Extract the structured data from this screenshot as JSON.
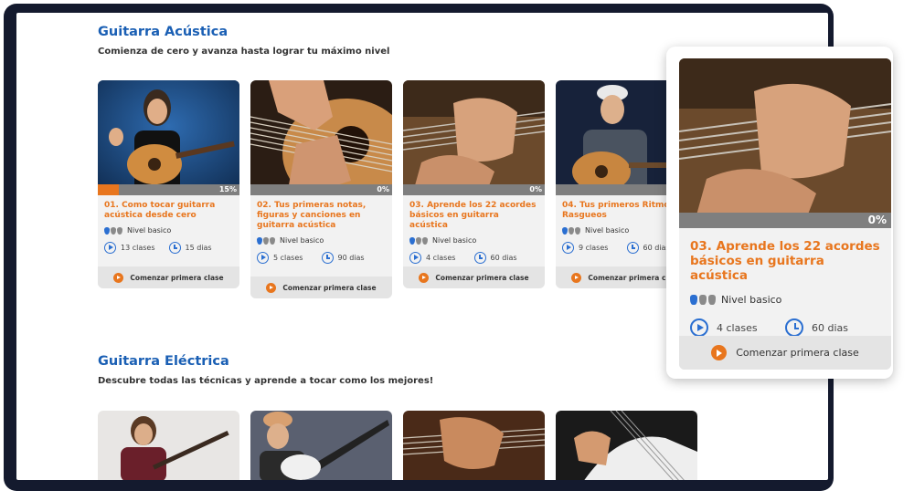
{
  "acoustic": {
    "title": "Guitarra Acústica",
    "subtitle": "Comienza de cero y avanza hasta lograr tu máximo nivel",
    "cards": [
      {
        "title": "01. Como tocar guitarra\nacústica desde cero",
        "progress": 15,
        "progress_label": "15%",
        "level": "Nivel basico",
        "level_picks": 1,
        "classes": "13 clases",
        "days": "15 dias",
        "cta": "Comenzar primera clase"
      },
      {
        "title": "02. Tus primeras notas,\nfiguras y canciones en\nguitarra acústica",
        "progress": 0,
        "progress_label": "0%",
        "level": "Nivel basico",
        "level_picks": 1,
        "classes": "5 clases",
        "days": "90 dias",
        "cta": "Comenzar primera clase"
      },
      {
        "title": "03. Aprende los 22 acordes\nbásicos en guitarra acústica",
        "progress": 0,
        "progress_label": "0%",
        "level": "Nivel basico",
        "level_picks": 1,
        "classes": "4 clases",
        "days": "60 dias",
        "cta": "Comenzar primera clase"
      },
      {
        "title": "04. Tus primeros Ritmos y\nRasgueos",
        "progress": 0,
        "progress_label": "0%",
        "level": "Nivel basico",
        "level_picks": 1,
        "classes": "9 clases",
        "days": "60 dias",
        "cta": "Comenzar primera clase"
      }
    ]
  },
  "electric": {
    "title": "Guitarra Eléctrica",
    "subtitle": "Descubre todas las técnicas y aprende a tocar como los mejores!"
  },
  "popup": {
    "title": "03. Aprende los 22 acordes\nbásicos en guitarra acústica",
    "progress": 0,
    "progress_label": "0%",
    "level": "Nivel basico",
    "classes": "4 clases",
    "days": "60 dias",
    "cta": "Comenzar primera clase"
  },
  "colors": {
    "accent": "#e8761e",
    "title_blue": "#1a5fb4",
    "icon_blue": "#2b6fd1",
    "frame": "#141a2e"
  }
}
